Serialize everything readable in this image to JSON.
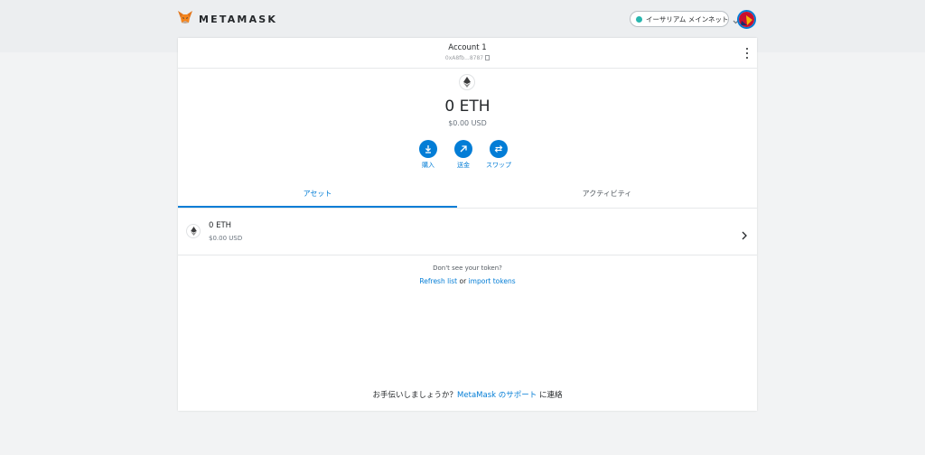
{
  "header": {
    "logo_text": "METAMASK",
    "network_label": "イーサリアム メインネット",
    "network_color": "#29b6af"
  },
  "account": {
    "name": "Account 1",
    "address": "0xA8fb...8787"
  },
  "balance": {
    "amount": "0 ETH",
    "fiat": "$0.00 USD"
  },
  "actions": {
    "buy": "購入",
    "send": "送金",
    "swap": "スワップ"
  },
  "tabs": {
    "assets": "アセット",
    "activity": "アクティビティ"
  },
  "asset_list": [
    {
      "amount": "0 ETH",
      "fiat": "$0.00 USD"
    }
  ],
  "token_help": {
    "question": "Don't see your token?",
    "refresh": "Refresh list",
    "or": " or ",
    "import": "import tokens"
  },
  "support": {
    "prefix": "お手伝いしましょうか？",
    "link": "MetaMask のサポート",
    "suffix": " に連絡"
  },
  "icons": {
    "fox": "metamask-fox-icon",
    "eth": "ethereum-icon",
    "buy": "download-icon",
    "send": "arrow-up-right-icon",
    "swap": "swap-arrows-icon"
  },
  "colors": {
    "accent": "#037dd6",
    "background": "#f2f3f4"
  }
}
